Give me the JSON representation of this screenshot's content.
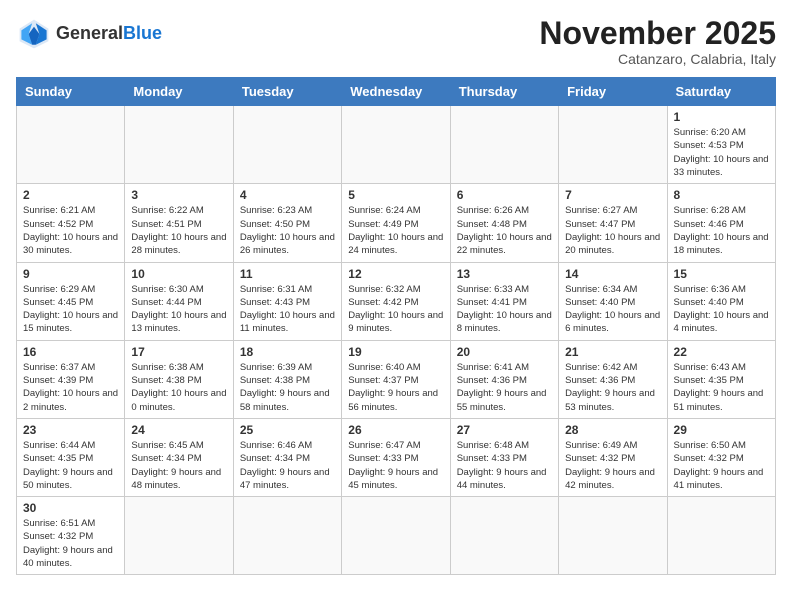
{
  "header": {
    "logo_general": "General",
    "logo_blue": "Blue",
    "month_title": "November 2025",
    "location": "Catanzaro, Calabria, Italy"
  },
  "weekdays": [
    "Sunday",
    "Monday",
    "Tuesday",
    "Wednesday",
    "Thursday",
    "Friday",
    "Saturday"
  ],
  "weeks": [
    [
      {
        "day": "",
        "info": ""
      },
      {
        "day": "",
        "info": ""
      },
      {
        "day": "",
        "info": ""
      },
      {
        "day": "",
        "info": ""
      },
      {
        "day": "",
        "info": ""
      },
      {
        "day": "",
        "info": ""
      },
      {
        "day": "1",
        "info": "Sunrise: 6:20 AM\nSunset: 4:53 PM\nDaylight: 10 hours and 33 minutes."
      }
    ],
    [
      {
        "day": "2",
        "info": "Sunrise: 6:21 AM\nSunset: 4:52 PM\nDaylight: 10 hours and 30 minutes."
      },
      {
        "day": "3",
        "info": "Sunrise: 6:22 AM\nSunset: 4:51 PM\nDaylight: 10 hours and 28 minutes."
      },
      {
        "day": "4",
        "info": "Sunrise: 6:23 AM\nSunset: 4:50 PM\nDaylight: 10 hours and 26 minutes."
      },
      {
        "day": "5",
        "info": "Sunrise: 6:24 AM\nSunset: 4:49 PM\nDaylight: 10 hours and 24 minutes."
      },
      {
        "day": "6",
        "info": "Sunrise: 6:26 AM\nSunset: 4:48 PM\nDaylight: 10 hours and 22 minutes."
      },
      {
        "day": "7",
        "info": "Sunrise: 6:27 AM\nSunset: 4:47 PM\nDaylight: 10 hours and 20 minutes."
      },
      {
        "day": "8",
        "info": "Sunrise: 6:28 AM\nSunset: 4:46 PM\nDaylight: 10 hours and 18 minutes."
      }
    ],
    [
      {
        "day": "9",
        "info": "Sunrise: 6:29 AM\nSunset: 4:45 PM\nDaylight: 10 hours and 15 minutes."
      },
      {
        "day": "10",
        "info": "Sunrise: 6:30 AM\nSunset: 4:44 PM\nDaylight: 10 hours and 13 minutes."
      },
      {
        "day": "11",
        "info": "Sunrise: 6:31 AM\nSunset: 4:43 PM\nDaylight: 10 hours and 11 minutes."
      },
      {
        "day": "12",
        "info": "Sunrise: 6:32 AM\nSunset: 4:42 PM\nDaylight: 10 hours and 9 minutes."
      },
      {
        "day": "13",
        "info": "Sunrise: 6:33 AM\nSunset: 4:41 PM\nDaylight: 10 hours and 8 minutes."
      },
      {
        "day": "14",
        "info": "Sunrise: 6:34 AM\nSunset: 4:40 PM\nDaylight: 10 hours and 6 minutes."
      },
      {
        "day": "15",
        "info": "Sunrise: 6:36 AM\nSunset: 4:40 PM\nDaylight: 10 hours and 4 minutes."
      }
    ],
    [
      {
        "day": "16",
        "info": "Sunrise: 6:37 AM\nSunset: 4:39 PM\nDaylight: 10 hours and 2 minutes."
      },
      {
        "day": "17",
        "info": "Sunrise: 6:38 AM\nSunset: 4:38 PM\nDaylight: 10 hours and 0 minutes."
      },
      {
        "day": "18",
        "info": "Sunrise: 6:39 AM\nSunset: 4:38 PM\nDaylight: 9 hours and 58 minutes."
      },
      {
        "day": "19",
        "info": "Sunrise: 6:40 AM\nSunset: 4:37 PM\nDaylight: 9 hours and 56 minutes."
      },
      {
        "day": "20",
        "info": "Sunrise: 6:41 AM\nSunset: 4:36 PM\nDaylight: 9 hours and 55 minutes."
      },
      {
        "day": "21",
        "info": "Sunrise: 6:42 AM\nSunset: 4:36 PM\nDaylight: 9 hours and 53 minutes."
      },
      {
        "day": "22",
        "info": "Sunrise: 6:43 AM\nSunset: 4:35 PM\nDaylight: 9 hours and 51 minutes."
      }
    ],
    [
      {
        "day": "23",
        "info": "Sunrise: 6:44 AM\nSunset: 4:35 PM\nDaylight: 9 hours and 50 minutes."
      },
      {
        "day": "24",
        "info": "Sunrise: 6:45 AM\nSunset: 4:34 PM\nDaylight: 9 hours and 48 minutes."
      },
      {
        "day": "25",
        "info": "Sunrise: 6:46 AM\nSunset: 4:34 PM\nDaylight: 9 hours and 47 minutes."
      },
      {
        "day": "26",
        "info": "Sunrise: 6:47 AM\nSunset: 4:33 PM\nDaylight: 9 hours and 45 minutes."
      },
      {
        "day": "27",
        "info": "Sunrise: 6:48 AM\nSunset: 4:33 PM\nDaylight: 9 hours and 44 minutes."
      },
      {
        "day": "28",
        "info": "Sunrise: 6:49 AM\nSunset: 4:32 PM\nDaylight: 9 hours and 42 minutes."
      },
      {
        "day": "29",
        "info": "Sunrise: 6:50 AM\nSunset: 4:32 PM\nDaylight: 9 hours and 41 minutes."
      }
    ],
    [
      {
        "day": "30",
        "info": "Sunrise: 6:51 AM\nSunset: 4:32 PM\nDaylight: 9 hours and 40 minutes."
      },
      {
        "day": "",
        "info": ""
      },
      {
        "day": "",
        "info": ""
      },
      {
        "day": "",
        "info": ""
      },
      {
        "day": "",
        "info": ""
      },
      {
        "day": "",
        "info": ""
      },
      {
        "day": "",
        "info": ""
      }
    ]
  ]
}
